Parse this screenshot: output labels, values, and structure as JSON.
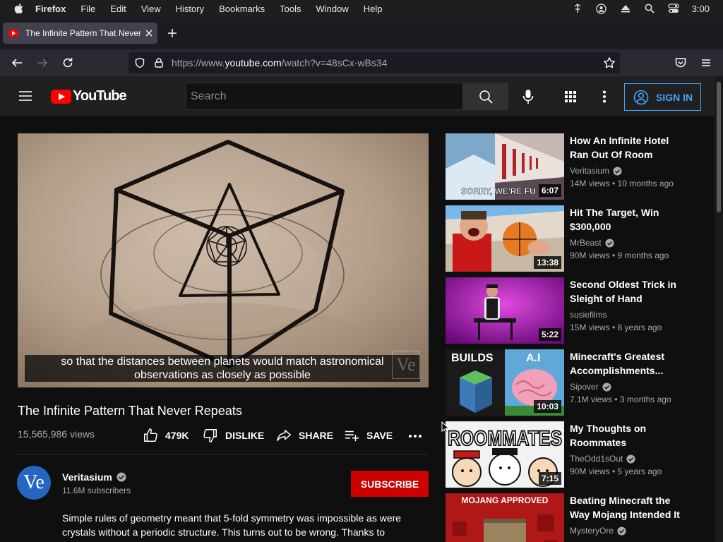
{
  "menubar": {
    "app": "Firefox",
    "items": [
      "File",
      "Edit",
      "View",
      "History",
      "Bookmarks",
      "Tools",
      "Window",
      "Help"
    ],
    "clock": "3:00"
  },
  "browser": {
    "tab_title": "The Infinite Pattern That Never Repeats",
    "url_prefix": "https://www.",
    "url_domain": "youtube.com",
    "url_path": "/watch?v=48sCx-wBs34"
  },
  "youtube": {
    "logo_text": "YouTube",
    "search_placeholder": "Search",
    "signin_label": "SIGN IN"
  },
  "video": {
    "caption_line1": "so that the distances between planets would match astronomical",
    "caption_line2": "observations as closely as possible",
    "watermark": "Ve",
    "title": "The Infinite Pattern That Never Repeats",
    "views": "15,565,986 views",
    "likes": "479K",
    "dislike_label": "DISLIKE",
    "share_label": "SHARE",
    "save_label": "SAVE"
  },
  "channel": {
    "avatar_text": "Ve",
    "name": "Veritasium",
    "subscribers": "11.6M subscribers",
    "subscribe_label": "SUBSCRIBE",
    "description": "Simple rules of geometry meant that 5-fold symmetry was impossible as were crystals without a periodic structure. This turns out to be wrong. Thanks to"
  },
  "recommendations": [
    {
      "title": "How An Infinite Hotel Ran Out Of Room",
      "channel": "Veritasium",
      "verified": true,
      "meta": "14M views • 10 months ago",
      "duration": "6:07",
      "thumb_text": "SORRY, WE'RE FU"
    },
    {
      "title": "Hit The Target, Win $300,000",
      "channel": "MrBeast",
      "verified": true,
      "meta": "90M views • 9 months ago",
      "duration": "13:38"
    },
    {
      "title": "Second Oldest Trick in Sleight of Hand",
      "channel": "susiefilms",
      "verified": false,
      "meta": "15M views • 8 years ago",
      "duration": "5:22"
    },
    {
      "title": "Minecraft's Greatest Accomplishments...",
      "channel": "Sipover",
      "verified": true,
      "meta": "7.1M views • 3 months ago",
      "duration": "10:03",
      "thumb_text_left": "BUILDS",
      "thumb_text_right": "A.I"
    },
    {
      "title": "My Thoughts on Roommates",
      "channel": "TheOdd1sOut",
      "verified": true,
      "meta": "90M views • 5 years ago",
      "duration": "7:15",
      "thumb_text": "ROOMMATES"
    },
    {
      "title": "Beating Minecraft the Way Mojang Intended It",
      "channel": "MysteryOre",
      "verified": true,
      "meta": "",
      "duration": "",
      "thumb_text": "MOJANG APPROVED"
    }
  ]
}
